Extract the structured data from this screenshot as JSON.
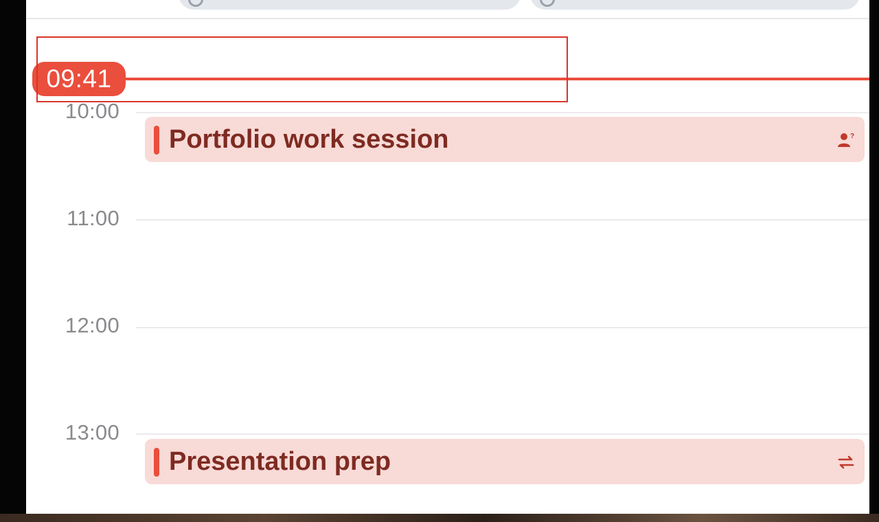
{
  "calendar": {
    "now_time": "09:41",
    "hours": [
      "10:00",
      "11:00",
      "12:00",
      "13:00"
    ],
    "events": [
      {
        "title": "Portfolio work session",
        "icon": "person-question-icon"
      },
      {
        "title": "Presentation prep",
        "icon": "repeat-icon"
      }
    ]
  },
  "colors": {
    "accent": "#ea4e3d",
    "event_bg": "#f8dad7",
    "event_text": "#7e2b22"
  }
}
